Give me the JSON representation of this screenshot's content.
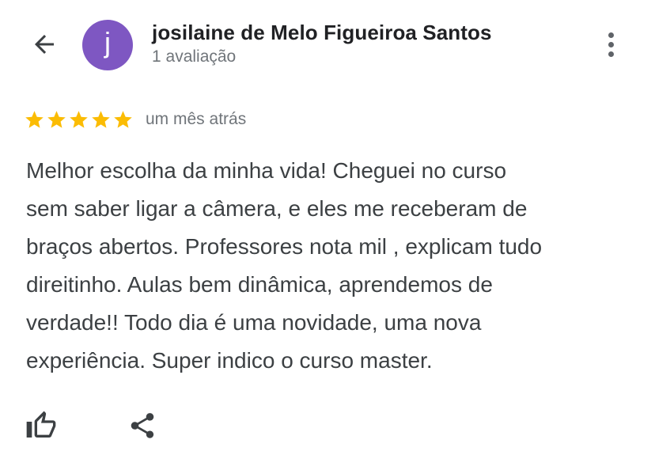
{
  "header": {
    "back_icon": "arrow-back-icon",
    "avatar_letter": "j",
    "avatar_color": "#7e57c2",
    "user_name": "josilaine de Melo Figueiroa Santos",
    "review_count": "1 avaliação",
    "more_icon": "more-vert-icon"
  },
  "review": {
    "rating": 5,
    "rating_max": 5,
    "star_color": "#fbbc04",
    "date": "um mês atrás",
    "text_lines": [
      "Melhor escolha da minha vida! Cheguei no curso",
      "sem saber ligar a câmera, e eles me receberam de",
      "braços abertos. Professores nota mil , explicam tudo",
      "direitinho. Aulas bem dinâmica, aprendemos de",
      "verdade!! Todo dia é uma novidade, uma nova",
      "experiência. Super indico o curso master."
    ]
  },
  "actions": {
    "like_icon": "thumb-up-icon",
    "share_icon": "share-icon"
  }
}
